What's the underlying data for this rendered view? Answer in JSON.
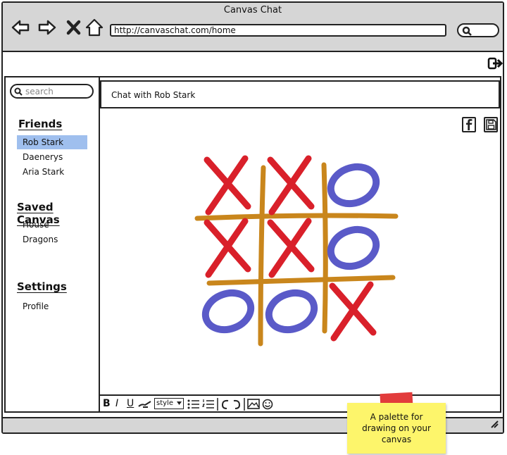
{
  "window": {
    "title": "Canvas Chat"
  },
  "toolbar": {
    "url": "http://canvaschat.com/home"
  },
  "icons": {
    "back": "back-arrow-icon",
    "forward": "forward-arrow-icon",
    "stop": "close-icon",
    "home": "home-icon",
    "search": "search-icon",
    "logout": "logout-icon",
    "facebook": "facebook-icon",
    "save": "save-icon"
  },
  "sidebar": {
    "search_placeholder": "search",
    "friends_title": "Friends",
    "friends": [
      "Rob Stark",
      "Daenerys",
      "Aria Stark"
    ],
    "active_friend": "Rob Stark",
    "saved_title": "Saved Canvas",
    "saved": [
      "House",
      "Dragons"
    ],
    "settings_title": "Settings",
    "settings": [
      "Profile"
    ]
  },
  "chat": {
    "header": "Chat with Rob Stark"
  },
  "canvas": {
    "board": [
      [
        "X",
        "X",
        "O"
      ],
      [
        "X",
        "X",
        "O"
      ],
      [
        "O",
        "O",
        "X"
      ]
    ]
  },
  "palette": {
    "bold": "B",
    "italic": "I",
    "underline": "U",
    "style_label": "style"
  },
  "note": {
    "text": "A palette for drawing on your canvas"
  },
  "colors": {
    "x_mark": "#d9202a",
    "o_mark": "#5a5ac8",
    "grid": "#c9861c",
    "selected": "#9fbfee",
    "note": "#fdf56b"
  }
}
